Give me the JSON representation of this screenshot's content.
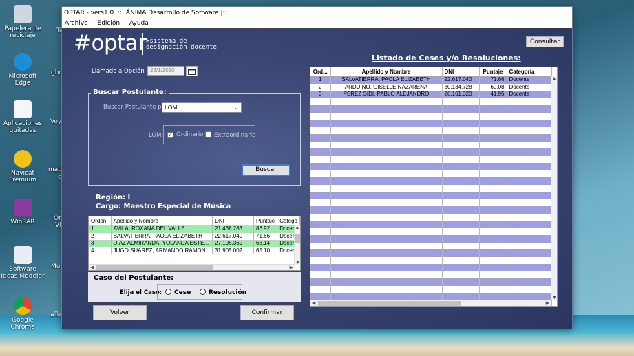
{
  "window": {
    "title": "OPTAR - vers1.0 .::| ÁNIMA Desarrollo de Software |::.",
    "menu": [
      "Archivo",
      "Edición",
      "Ayuda"
    ]
  },
  "desktop": {
    "icons": [
      {
        "label": "Papelera de reciclaje",
        "icon": "recycle-bin-icon"
      },
      {
        "label": "Microsoft Edge",
        "icon": "edge-icon"
      },
      {
        "label": "Aplicaciones quitadas",
        "icon": "document-icon"
      },
      {
        "label": "Navicat Premium",
        "icon": "navicat-icon"
      },
      {
        "label": "WinRAR",
        "icon": "winrar-icon"
      },
      {
        "label": "Software Ideas Modeler",
        "icon": "modeler-icon"
      },
      {
        "label": "Google Chrome",
        "icon": "chrome-icon"
      }
    ],
    "partial_labels": [
      "Te",
      "ghci",
      "Voy a",
      "matla",
      "d",
      "Ora",
      "Vir",
      "Mus",
      "aTub"
    ]
  },
  "logo": {
    "main": "#optar",
    "sub_line1": ">sistema de",
    "sub_line2": "designación docente"
  },
  "consultar_label": "Consultar",
  "llamado": {
    "label": "Llamado a Opción del:",
    "date": "28/1/2020"
  },
  "buscar_group": {
    "title": "Buscar Postulante:",
    "por_label": "Buscar Postulante por:",
    "por_value": "LOM",
    "lom_label": "LOM:",
    "ordinario": "Ordinario",
    "extraordinario": "Extraordinario",
    "ordinario_checked": true,
    "buscar_label": "Buscar"
  },
  "region": "Región: I",
  "cargo": "Cargo: Maestro Especial de Música",
  "postulantes": {
    "headers": [
      "Orden",
      "Apellido y Nombre",
      "DNI",
      "Puntaje",
      "Catego"
    ],
    "rows": [
      [
        "1",
        "AVILA, ROXANA DEL VALLE",
        "21.468.283",
        "86.92",
        "Docen"
      ],
      [
        "2",
        "SALVATIERRA, PAOLA  ELIZABETH",
        "22.617.040",
        "71.66",
        "Docen"
      ],
      [
        "3",
        "DIAZ ALMIRANDA, YOLANDA ESTE...",
        "27.198.369",
        "66.14",
        "Docen"
      ],
      [
        "4",
        "JUGO SUAREZ, ARMANDO RAMON...",
        "31.905.002",
        "65.10",
        "Docen"
      ]
    ]
  },
  "caso": {
    "title": "Caso del Postulante:",
    "elija": "Elija el Caso:",
    "cese": "Cese",
    "resolucion": "Resolución"
  },
  "volver_label": "Volver",
  "confirmar_label": "Confirmar",
  "ceses": {
    "title": "Listado de Ceses y/o Resoluciones:",
    "headers": [
      "Ord...",
      "Apellido y Nombre",
      "DNI",
      "Puntaje",
      "Categoría"
    ],
    "rows": [
      [
        "1",
        "SALVATIERRA, PAOLA  ELIZABETH",
        "22.617.040",
        "71.66",
        "Docente"
      ],
      [
        "2",
        "ARDUINO, GISELLE NAZARENA",
        "30.134.728",
        "60.08",
        "Docente"
      ],
      [
        "3",
        "PEREZ SIDI, PABLO ALEJANDRO",
        "26.161.320",
        "41.95",
        "Docente"
      ]
    ]
  }
}
